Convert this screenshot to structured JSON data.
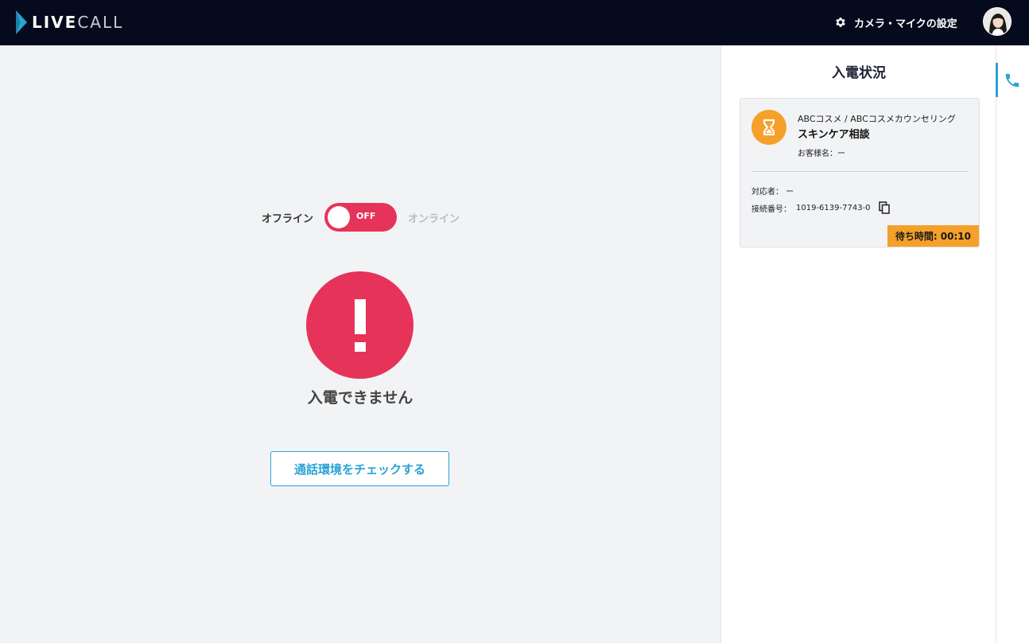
{
  "header": {
    "logo": {
      "live": "LIVE",
      "call": "CALL"
    },
    "settings_label": "カメラ・マイクの設定",
    "settings_icon": "gear-icon",
    "avatar": "user-avatar"
  },
  "main": {
    "offline_label": "オフライン",
    "online_label": "オンライン",
    "toggle_state": "OFF",
    "alert_icon": "exclamation-icon",
    "alert_message": "入電できません",
    "check_button": "通話環境をチェックする"
  },
  "panel": {
    "title": "入電状況",
    "card": {
      "icon": "hourglass-icon",
      "company": "ABCコスメ / ABCコスメカウンセリング",
      "title": "スキンケア相談",
      "customer": "お客様名：ー",
      "agent": "対応者：  ー",
      "connection_label": "接続番号：",
      "connection_number": "1019-6139-7743-0",
      "wait_label": "待ち時間: 00:10"
    }
  },
  "strip": {
    "icon": "phone-icon"
  },
  "colors": {
    "header_bg": "#050a1c",
    "accent_red": "#e6335a",
    "accent_blue": "#2aa3d4",
    "accent_orange": "#f5a02a"
  }
}
